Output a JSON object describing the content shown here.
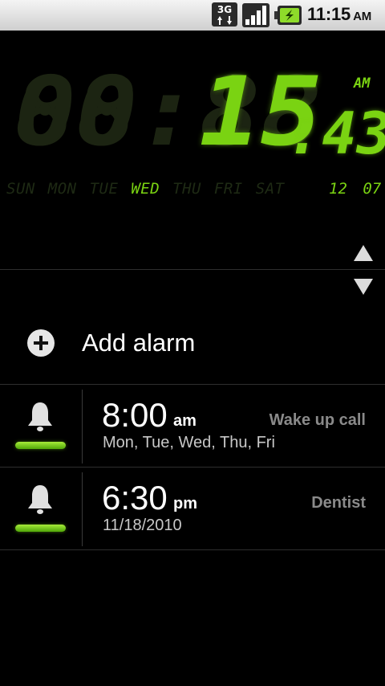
{
  "status_bar": {
    "network": "3G",
    "time": "11:15",
    "ampm": "AM",
    "icons": [
      "3g-data-icon",
      "signal-strength-icon",
      "battery-charging-icon"
    ]
  },
  "clock": {
    "ghost_digits": "88:88",
    "hours": "00",
    "colon": ":",
    "minutes": "15",
    "seconds_sep": ":",
    "seconds": "43",
    "ampm": "AM",
    "days": [
      "SUN",
      "MON",
      "TUE",
      "WED",
      "THU",
      "FRI",
      "SAT"
    ],
    "active_day": "WED",
    "month": "12",
    "day": "07",
    "digit_color": "#7ad312"
  },
  "controls": {
    "scroll_up": "arrow-up-icon",
    "scroll_down": "arrow-down-icon"
  },
  "add_alarm": {
    "label": "Add alarm",
    "icon": "plus-circle-icon"
  },
  "alarms": [
    {
      "time": "8:00",
      "ampm": "am",
      "repeat": "Mon, Tue, Wed, Thu, Fri",
      "label": "Wake up call",
      "enabled": true,
      "icon": "bell-icon"
    },
    {
      "time": "6:30",
      "ampm": "pm",
      "repeat": "11/18/2010",
      "label": "Dentist",
      "enabled": true,
      "icon": "bell-icon"
    }
  ]
}
